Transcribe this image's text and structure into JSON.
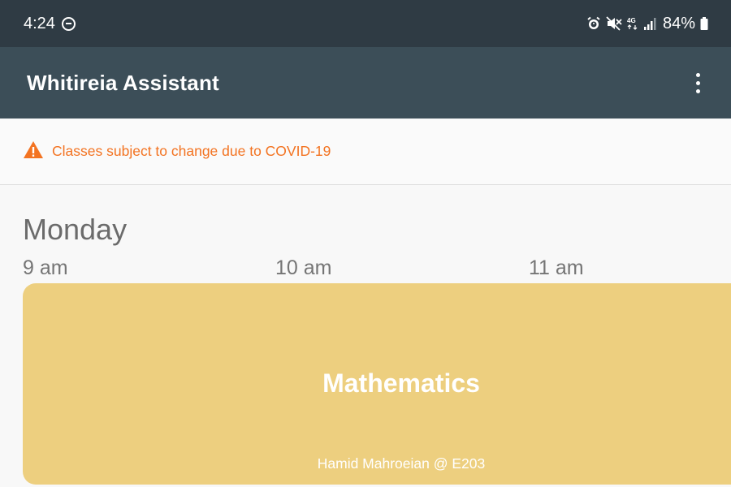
{
  "status_bar": {
    "time": "4:24",
    "battery": "84%",
    "icons": [
      "do-not-disturb-icon",
      "alarm-icon",
      "mute-icon",
      "4g-icon",
      "signal-icon",
      "battery-icon"
    ]
  },
  "app_bar": {
    "title": "Whitireia Assistant",
    "menu_icon": "more-vert-icon"
  },
  "notice": {
    "icon": "warning-icon",
    "text": "Classes subject to change due to COVID-19",
    "color": "#f37321"
  },
  "schedule": {
    "day": "Monday",
    "hours": [
      "9 am",
      "10 am",
      "11 am"
    ],
    "classes": [
      {
        "name": "Mathematics",
        "details": "Hamid Mahroeian @ E203",
        "color": "#edcf7f"
      }
    ]
  }
}
